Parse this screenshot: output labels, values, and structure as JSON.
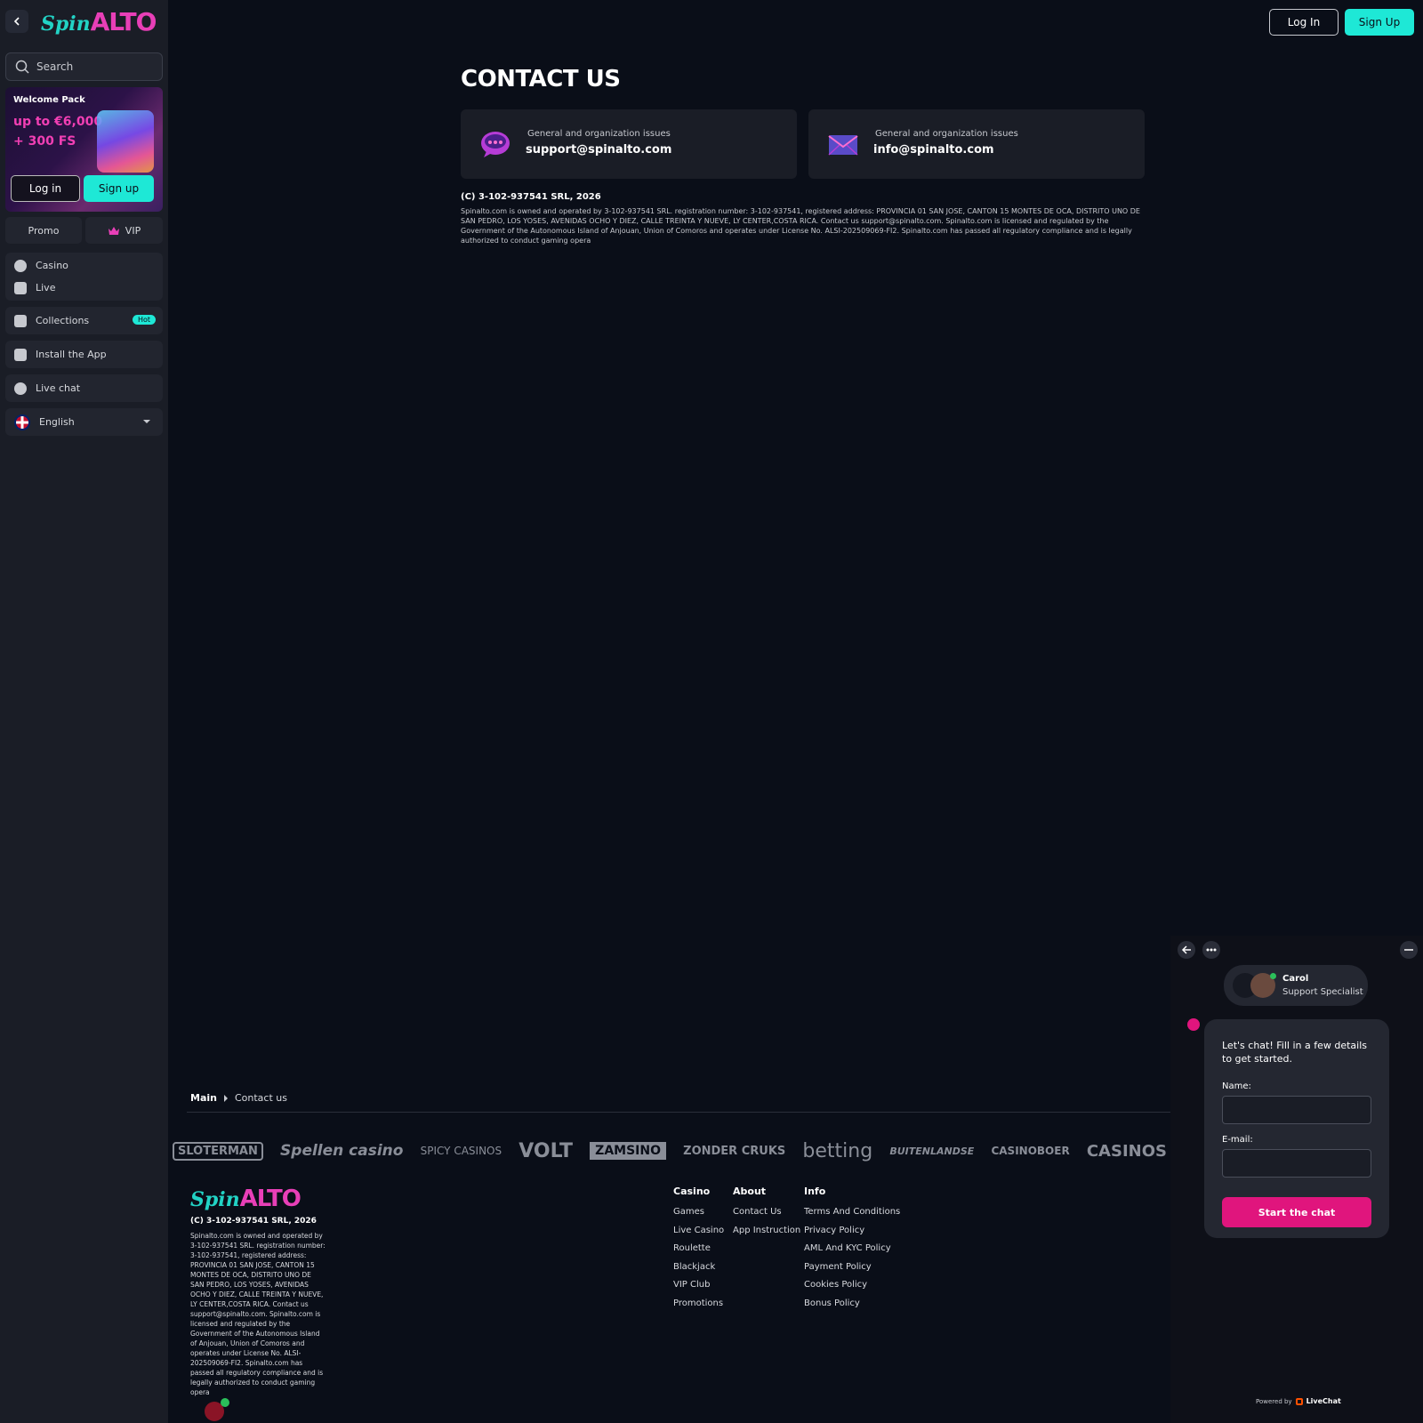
{
  "brand": {
    "logo_spin": "Spin",
    "logo_alto": "ALTO"
  },
  "sidebar": {
    "search_placeholder": "Search",
    "welcome": {
      "title": "Welcome Pack",
      "line1": "up to €6,000",
      "line2": "+ 300 FS",
      "login": "Log in",
      "signup": "Sign up"
    },
    "promo": "Promo",
    "vip": "VIP",
    "items": [
      {
        "label": "Casino",
        "icon": "casino-icon"
      },
      {
        "label": "Live",
        "icon": "dice-icon"
      },
      {
        "label": "Collections",
        "icon": "puzzle-icon",
        "badge": "Hot"
      },
      {
        "label": "Install the App",
        "icon": "download-icon"
      },
      {
        "label": "Live chat",
        "icon": "chat-icon"
      }
    ],
    "language": "English"
  },
  "header": {
    "login": "Log In",
    "signup": "Sign Up"
  },
  "main": {
    "title": "CONTACT US",
    "cards": [
      {
        "label": "General and organization issues",
        "value": "support@spinalto.com",
        "icon": "chat-bubble-icon"
      },
      {
        "label": "General and organization issues",
        "value": "info@spinalto.com",
        "icon": "envelope-icon"
      }
    ],
    "copyright": "(C) 3-102-937541 SRL, 2026",
    "legal": "Spinalto.com is owned and operated by 3-102-937541 SRL. registration number: 3-102-937541, registered address: PROVINCIA 01 SAN JOSE, CANTON 15 MONTES DE OCA, DISTRITO UNO DE SAN PEDRO, LOS YOSES, AVENIDAS OCHO Y DIEZ, CALLE TREINTA Y NUEVE, LY CENTER,COSTA RICA. Contact us support@spinalto.com. Spinalto.com is licensed and regulated by the Government of the Autonomous Island of Anjouan, Union of Comoros and operates under License No. ALSI-202509069-FI2. Spinalto.com has passed all regulatory compliance and is legally authorized to conduct gaming opera"
  },
  "breadcrumb": {
    "main": "Main",
    "current": "Contact us"
  },
  "partners": [
    "SLOTERMAN",
    "Spellen casino",
    "SPICY CASINOS",
    "VOLT",
    "ZAMSINO",
    "ZONDER CRUKS",
    "betting",
    "BUITENLANDSE",
    "CASINOBOER",
    "CASINOS"
  ],
  "footer": {
    "copyright": "(C) 3-102-937541 SRL, 2026",
    "legal": "Spinalto.com is owned and operated by 3-102-937541 SRL. registration number: 3-102-937541, registered address: PROVINCIA 01 SAN JOSE, CANTON 15 MONTES DE OCA, DISTRITO UNO DE SAN PEDRO, LOS YOSES, AVENIDAS OCHO Y DIEZ, CALLE TREINTA Y NUEVE, LY CENTER,COSTA RICA. Contact us support@spinalto.com. Spinalto.com is licensed and regulated by the Government of the Autonomous Island of Anjouan, Union of Comoros and operates under License No. ALSI-202509069-FI2. Spinalto.com has passed all regulatory compliance and is legally authorized to conduct gaming opera",
    "columns": [
      {
        "heading": "Casino",
        "links": [
          "Games",
          "Live Casino",
          "Roulette",
          "Blackjack",
          "VIP Club",
          "Promotions"
        ]
      },
      {
        "heading": "About",
        "links": [
          "Contact Us",
          "App Instruction"
        ]
      },
      {
        "heading": "Info",
        "links": [
          "Terms And Conditions",
          "Privacy Policy",
          "AML And KYC Policy",
          "Payment Policy",
          "Cookies Policy",
          "Bonus Policy"
        ]
      }
    ]
  },
  "chat": {
    "agent_name": "Carol",
    "agent_role": "Support Specialist",
    "intro": "Let's chat! Fill in a few details to get started.",
    "name_label": "Name:",
    "email_label": "E-mail:",
    "start": "Start the chat",
    "powered_by": "Powered by",
    "powered_brand": "LiveChat"
  },
  "colors": {
    "accent_teal": "#1ee8d6",
    "accent_pink": "#e83fb7",
    "chat_pink": "#e0157d",
    "bg": "#0a0e18",
    "panel": "#1a1d26"
  }
}
